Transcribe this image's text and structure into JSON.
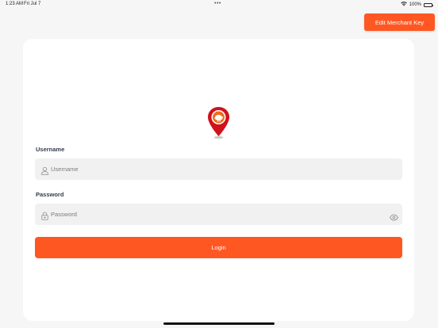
{
  "status_bar": {
    "time": "1:23 AM",
    "date": "Fri Jul 7",
    "dots": "•••",
    "battery_percent": "100%"
  },
  "header": {
    "edit_merchant_key_label": "Edit Merchant Key"
  },
  "login_form": {
    "username_label": "Username",
    "username_placeholder": "Username",
    "username_value": "",
    "password_label": "Password",
    "password_placeholder": "Password",
    "password_value": "",
    "login_label": "Login"
  },
  "icons": {
    "logo": "map-pin-logo-icon",
    "username": "user-icon",
    "password": "lock-icon",
    "show_password": "eye-icon"
  },
  "colors": {
    "accent": "#ff5722",
    "logo_red": "#d0121b",
    "background": "#f6f6f7",
    "card": "#ffffff",
    "field_bg": "#f1f1f2"
  }
}
